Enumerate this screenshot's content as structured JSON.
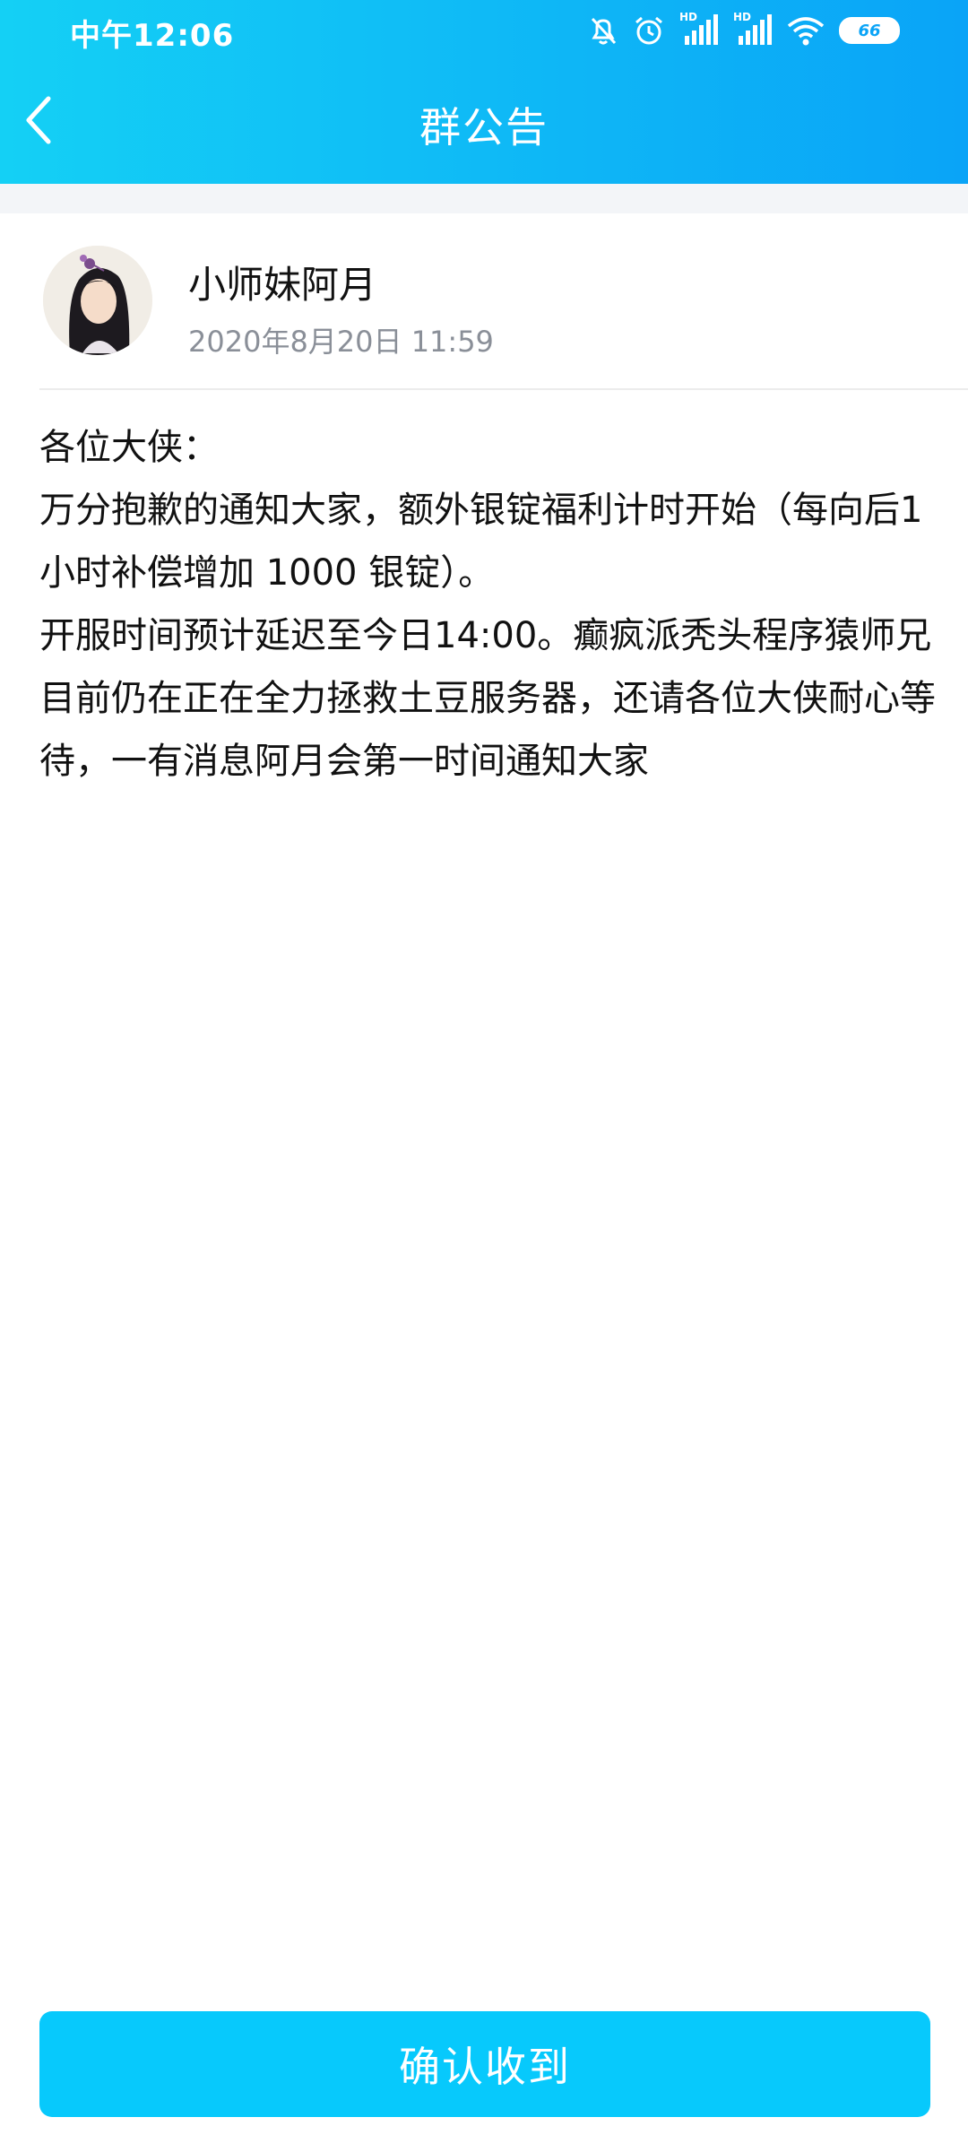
{
  "status_bar": {
    "time": "中午12:06",
    "hd_label_1": "HD",
    "hd_label_2": "HD",
    "battery": "66",
    "icons": [
      "bell-off-icon",
      "alarm-icon",
      "signal-icon",
      "signal-icon",
      "wifi-icon",
      "battery-icon"
    ]
  },
  "header": {
    "title": "群公告",
    "back_icon": "chevron-left-icon",
    "gradient_start": "#14d0f5",
    "gradient_end": "#0aa4f7"
  },
  "author": {
    "name": "小师妹阿月",
    "time": "2020年8月20日 11:59"
  },
  "announcement": {
    "lines": [
      "各位大侠：",
      "万分抱歉的通知大家，额外银锭福利计时开始（每向后1小时补偿增加 1000 银锭）。",
      "开服时间预计延迟至今日14:00。癫疯派秃头程序猿师兄目前仍在正在全力拯救土豆服务器，还请各位大侠耐心等待，一有消息阿月会第一时间通知大家"
    ]
  },
  "footer": {
    "confirm_label": "确认收到",
    "button_color": "#07c9fc"
  }
}
